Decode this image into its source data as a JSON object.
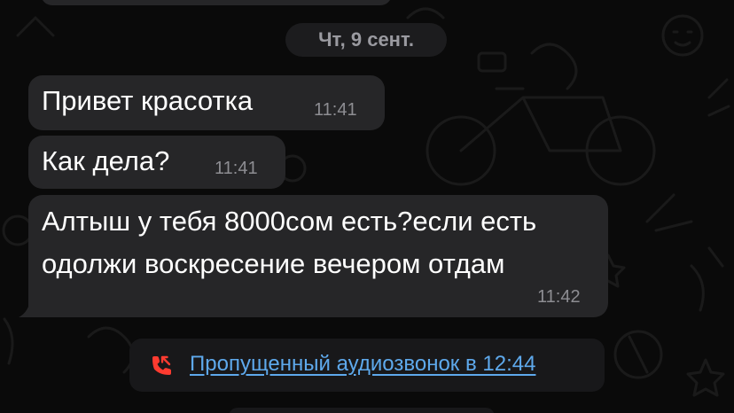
{
  "date_separator": "Чт, 9 сент.",
  "messages": [
    {
      "text": "Привет красотка",
      "time": "11:41"
    },
    {
      "text": "Как дела?",
      "time": "11:41"
    },
    {
      "lines": [
        "Алтыш у тебя 8000сом есть?если есть",
        "одолжи воскресение вечером отдам"
      ],
      "time": "11:42"
    }
  ],
  "missed_call": {
    "text": "Пропущенный аудиозвонок в 12:44",
    "icon": "missed-call-icon"
  },
  "colors": {
    "background": "#0a0a0a",
    "bubble": "#262628",
    "link": "#5ea9ec",
    "missed_call_icon": "#ff3b30",
    "timestamp": "#8d8d92"
  }
}
